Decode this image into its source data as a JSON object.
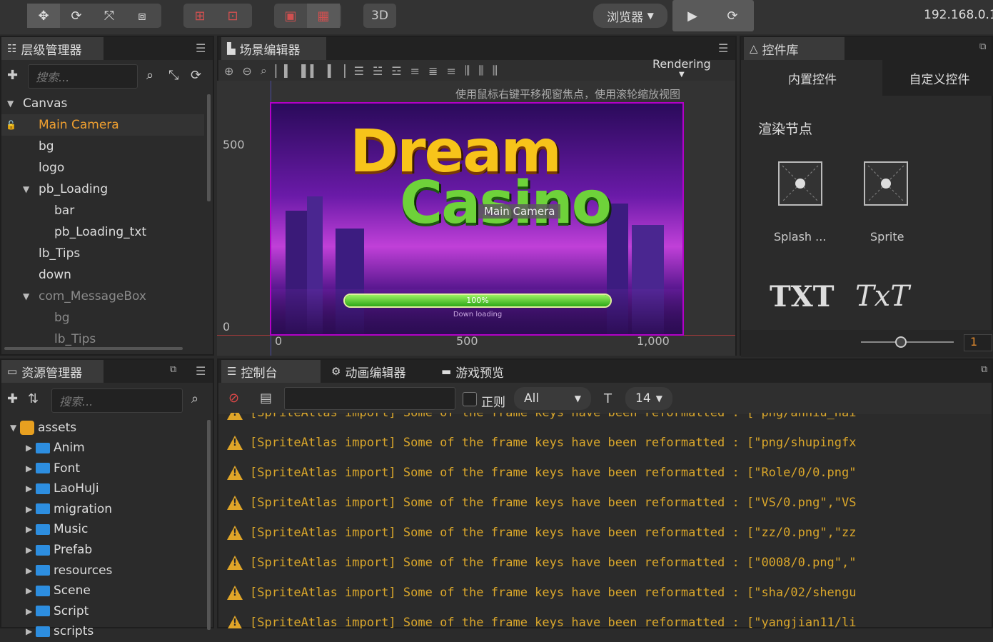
{
  "toolbar": {
    "mode_3d": "3D",
    "browser_label": "浏览器",
    "ip": "192.168.0.1"
  },
  "hierarchy": {
    "title": "层级管理器",
    "search_placeholder": "搜索...",
    "nodes": [
      {
        "label": "Canvas",
        "depth": 1,
        "expanded": true
      },
      {
        "label": "Main Camera",
        "depth": 2,
        "selected": true
      },
      {
        "label": "bg",
        "depth": 2
      },
      {
        "label": "logo",
        "depth": 2
      },
      {
        "label": "pb_Loading",
        "depth": 2,
        "expanded": true
      },
      {
        "label": "bar",
        "depth": 3
      },
      {
        "label": "pb_Loading_txt",
        "depth": 3
      },
      {
        "label": "lb_Tips",
        "depth": 2
      },
      {
        "label": "down",
        "depth": 2
      },
      {
        "label": "com_MessageBox",
        "depth": 2,
        "expanded": true,
        "dim": true
      },
      {
        "label": "bg",
        "depth": 3,
        "dim": true
      },
      {
        "label": "lb_Tips",
        "depth": 3,
        "dim": true
      }
    ]
  },
  "scene": {
    "title": "场景编辑器",
    "rendering_label": "Rendering",
    "hint": "使用鼠标右键平移视窗焦点，使用滚轮缩放视图",
    "axis_y": [
      "500",
      "0"
    ],
    "axis_x": [
      "0",
      "500",
      "1,000"
    ],
    "camera_label": "Main Camera",
    "logo_line1": "Dream",
    "logo_line2": "Casino",
    "progress_text": "100%",
    "progress_subtext": "Down loading",
    "progress": 1.0
  },
  "library": {
    "title": "控件库",
    "tab_builtin": "内置控件",
    "tab_custom": "自定义控件",
    "section": "渲染节点",
    "items": [
      "Splash ...",
      "Sprite"
    ],
    "text_items": [
      "TXT",
      "TxT"
    ],
    "zoom_value": "1"
  },
  "assets": {
    "title": "资源管理器",
    "search_placeholder": "搜索...",
    "root": "assets",
    "folders": [
      "Anim",
      "Font",
      "LaoHuJi",
      "migration",
      "Music",
      "Prefab",
      "resources",
      "Scene",
      "Script",
      "scripts"
    ]
  },
  "console": {
    "tabs": [
      "控制台",
      "动画编辑器",
      "游戏预览"
    ],
    "regex_label": "正则",
    "level_select": "All",
    "font_size": "14",
    "partial_top": "[SpriteAtlas import] Some of the frame keys have been reformatted : [\"png/anniu_nai",
    "lines": [
      "[SpriteAtlas import] Some of the frame keys have been reformatted : [\"png/shupingfx",
      "[SpriteAtlas import] Some of the frame keys have been reformatted : [\"Role/0/0.png\"",
      "[SpriteAtlas import] Some of the frame keys have been reformatted : [\"VS/0.png\",\"VS",
      "[SpriteAtlas import] Some of the frame keys have been reformatted : [\"zz/0.png\",\"zz",
      "[SpriteAtlas import] Some of the frame keys have been reformatted : [\"0008/0.png\",\"",
      "[SpriteAtlas import] Some of the frame keys have been reformatted : [\"sha/02/shengu",
      "[SpriteAtlas import] Some of the frame keys have been reformatted : [\"yangjian11/li"
    ]
  }
}
